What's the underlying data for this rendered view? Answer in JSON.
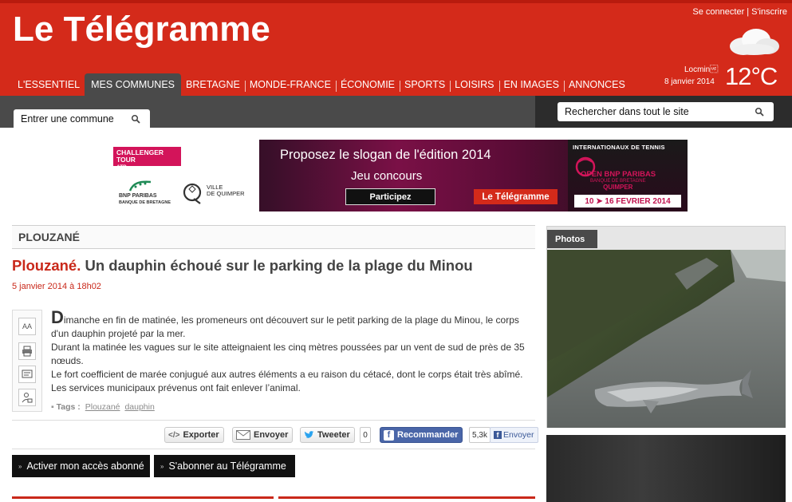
{
  "header": {
    "logo": "Le Télégramme",
    "auth": {
      "login": "Se connecter",
      "separator": "|",
      "register": "S'inscrire"
    },
    "weather": {
      "city": "Locmin\u001f",
      "date": "8 janvier 2014",
      "temp": "12°C",
      "icon": "cloud-icon"
    }
  },
  "nav": {
    "items": [
      {
        "label": "L'ESSENTIEL"
      },
      {
        "label": "MES COMMUNES",
        "active": true
      },
      {
        "label": "BRETAGNE"
      },
      {
        "label": "MONDE-FRANCE"
      },
      {
        "label": "ÉCONOMIE"
      },
      {
        "label": "SPORTS"
      },
      {
        "label": "LOISIRS"
      },
      {
        "label": "EN IMAGES"
      },
      {
        "label": "ANNONCES"
      }
    ]
  },
  "search": {
    "commune_placeholder": "Entrer une commune",
    "site_placeholder": "Rechercher dans tout le site"
  },
  "banner": {
    "atp": "CHALLENGER TOUR",
    "atp_logo": "ATP",
    "bnp": "BNP PARIBAS",
    "bnp_sub": "BANQUE DE BRETAGNE",
    "ville": "VILLE",
    "de_quimper": "DE QUIMPER",
    "headline": "Proposez le slogan de l'édition 2014",
    "sub": "Jeu concours",
    "button": "Participez",
    "brand": "Le Télégramme",
    "event": "INTERNATIONAUX DE TENNIS",
    "open": "OPEN BNP PARIBAS",
    "open_sub": "BANQUE DE BRETAGNE",
    "open_city": "QUIMPER",
    "dates": "10 ➤ 16 FEVRIER 2014"
  },
  "article": {
    "section": "PLOUZANÉ",
    "headline_city": "Plouzané.",
    "headline_rest": "Un dauphin échoué sur le parking de la plage du Minou",
    "date": "5 janvier 2014 à 18h02",
    "dropcap": "D",
    "paragraphs": [
      "imanche en fin de matinée, les promeneurs ont découvert sur le petit parking de la plage du Minou, le corps d'un dauphin projeté par la mer.",
      "Durant la matinée les vagues sur le site atteignaient les cinq mètres poussées par un vent de sud de près de 35 nœuds.",
      "Le fort coefficient de marée conjugué aux autres éléments a eu raison du cétacé, dont le corps était très abîmé.",
      "Les services municipaux prévenus ont fait enlever l’animal."
    ],
    "tags_label": "Tags :",
    "tags": [
      "Plouzané",
      "dauphin"
    ],
    "tools": {
      "font": "AA"
    }
  },
  "share": {
    "export": "Exporter",
    "send": "Envoyer",
    "tweet": "Tweeter",
    "tweet_count": "0",
    "recommend": "Recommander",
    "recommend_count": "5,3k",
    "fb_send": "Envoyer"
  },
  "subscriptions": {
    "activate": "Activer mon accès abonné",
    "subscribe": "S'abonner au Télégramme"
  },
  "sidebar": {
    "photos_tab": "Photos"
  },
  "colors": {
    "brand_red": "#d42a1a",
    "nav_dark": "#4a4a4a",
    "headline_red": "#c9281a",
    "facebook": "#4a66a8"
  }
}
